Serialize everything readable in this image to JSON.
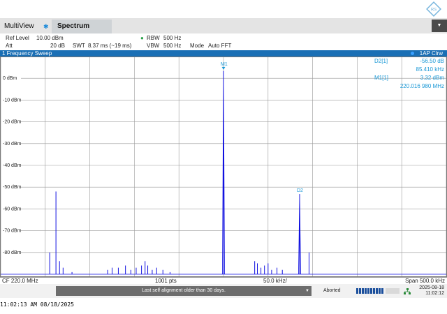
{
  "tabs": {
    "multiview": "MultiView",
    "star": "✱",
    "spectrum": "Spectrum"
  },
  "settings": {
    "ref_level_label": "Ref Level",
    "ref_level": "10.00 dBm",
    "att_label": "Att",
    "att": "20 dB",
    "swt_label": "SWT",
    "swt": "8.37 ms (~19 ms)",
    "rbw_label": "RBW",
    "rbw": "500 Hz",
    "vbw_label": "VBW",
    "vbw": "500 Hz",
    "mode_label": "Mode",
    "mode": "Auto FFT"
  },
  "sweep": {
    "title": "1 Frequency Sweep",
    "trace_info": "1AP Clrw"
  },
  "markers": [
    {
      "name": "D2[1]",
      "val1": "-56.50 dB",
      "val2": "85.410 kHz"
    },
    {
      "name": "M1[1]",
      "val1": "3.32 dBm",
      "val2": "220.016 980 MHz"
    }
  ],
  "marker_labels": {
    "m1": "M1",
    "d2": "D2"
  },
  "axis": {
    "cf": "CF 220.0 MHz",
    "pts": "1001 pts",
    "div": "50.0 kHz/",
    "span": "Span 500.0 kHz"
  },
  "status": {
    "message": "Last self alignment older than 30 days.",
    "aborted": "Aborted",
    "date": "2025-08-18",
    "time": "11:02:12"
  },
  "footer": "11:02:13 AM  08/18/2025",
  "colors": {
    "trace": "#1010e0",
    "accent": "#1a6fb5",
    "marker": "#1a98d6"
  },
  "chart_data": {
    "type": "line",
    "ylim": [
      -90,
      10
    ],
    "yticks": [
      "0 dBm",
      "-10 dBm",
      "-20 dBm",
      "-30 dBm",
      "-40 dBm",
      "-50 dBm",
      "-60 dBm",
      "-70 dBm",
      "-80 dBm"
    ],
    "xlim_khz": [
      -250,
      250
    ],
    "peaks_khz": [
      {
        "x": -195,
        "y": -80
      },
      {
        "x": -188,
        "y": -52
      },
      {
        "x": -184,
        "y": -84
      },
      {
        "x": -180,
        "y": -87
      },
      {
        "x": -170,
        "y": -89
      },
      {
        "x": -130,
        "y": -88
      },
      {
        "x": -125,
        "y": -87
      },
      {
        "x": -118,
        "y": -87
      },
      {
        "x": -110,
        "y": -86
      },
      {
        "x": -104,
        "y": -88
      },
      {
        "x": -98,
        "y": -87
      },
      {
        "x": -92,
        "y": -86
      },
      {
        "x": -88,
        "y": -84
      },
      {
        "x": -85,
        "y": -86
      },
      {
        "x": -80,
        "y": -88
      },
      {
        "x": -75,
        "y": -87
      },
      {
        "x": -68,
        "y": -88
      },
      {
        "x": -60,
        "y": -89
      },
      {
        "x": 0,
        "y": 3.32
      },
      {
        "x": 35,
        "y": -84
      },
      {
        "x": 38,
        "y": -85
      },
      {
        "x": 42,
        "y": -87
      },
      {
        "x": 46,
        "y": -86
      },
      {
        "x": 50,
        "y": -85
      },
      {
        "x": 54,
        "y": -88
      },
      {
        "x": 60,
        "y": -87
      },
      {
        "x": 66,
        "y": -88
      },
      {
        "x": 85.41,
        "y": -53.2
      },
      {
        "x": 96,
        "y": -80
      }
    ]
  }
}
